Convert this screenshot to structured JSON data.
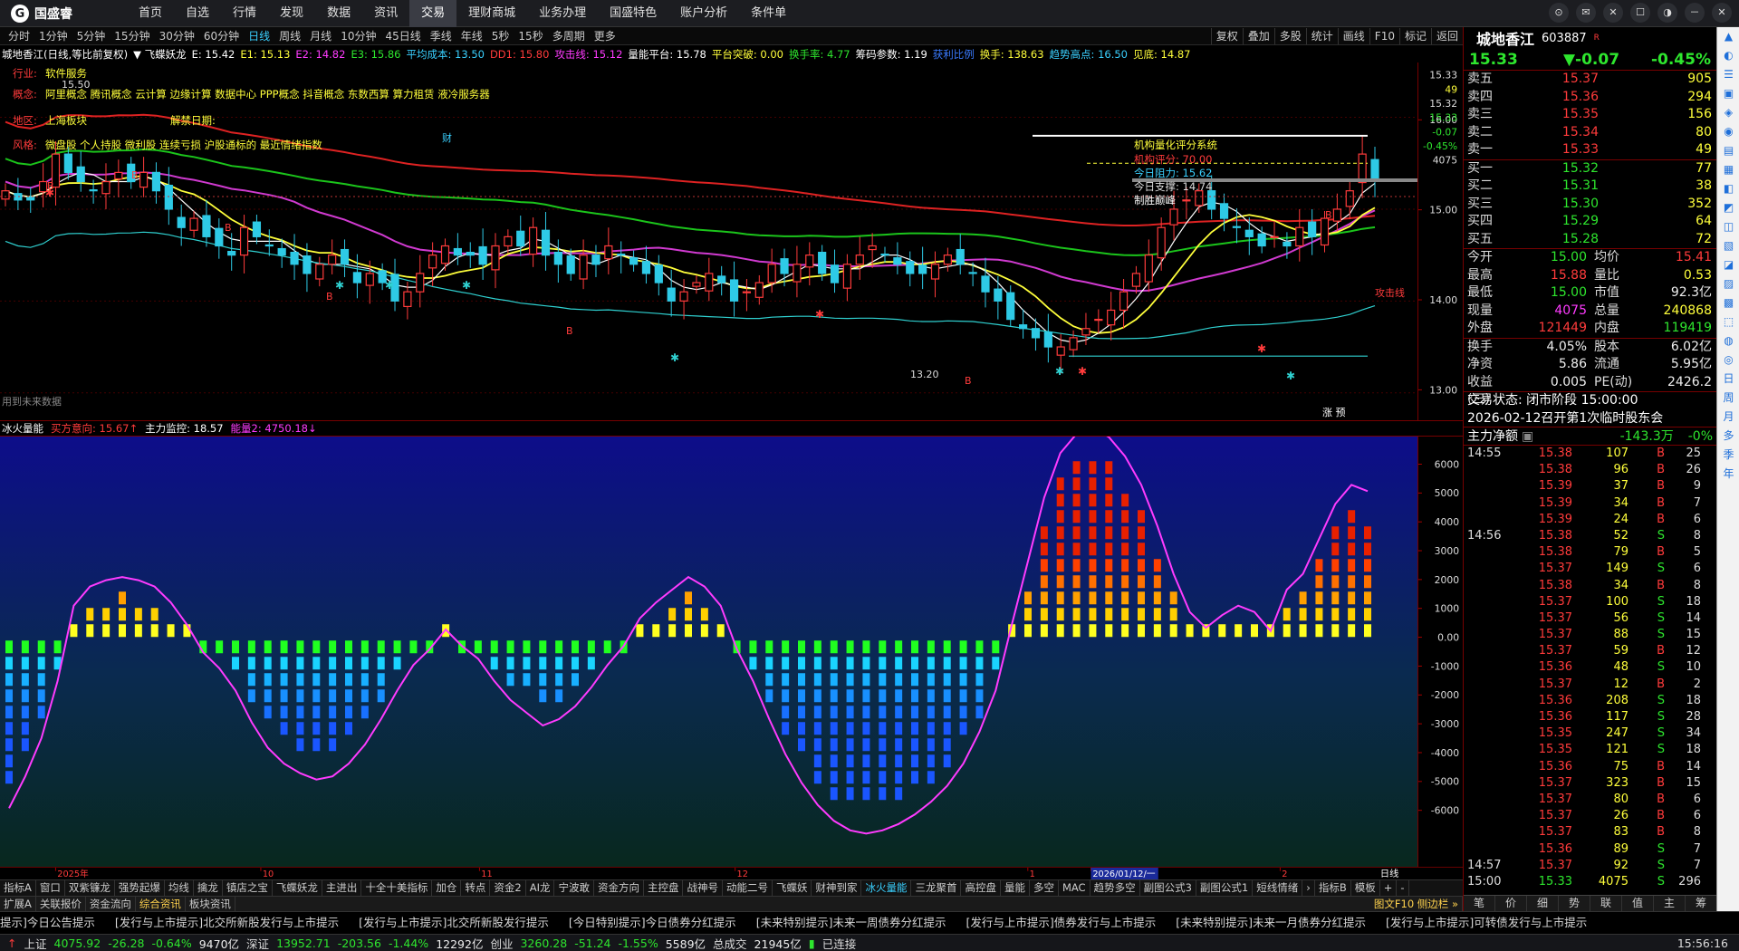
{
  "app": {
    "logo_text": "国盛睿",
    "logo_mark": "G"
  },
  "menu": [
    "首页",
    "自选",
    "行情",
    "发现",
    "数据",
    "资讯",
    "交易",
    "理财商城",
    "业务办理",
    "国盛特色",
    "账户分析",
    "条件单"
  ],
  "menu_active": "交易",
  "window_buttons": [
    "⊙",
    "✉",
    "✕",
    "☐",
    "◑",
    "－",
    "✕"
  ],
  "periods": [
    "分时",
    "1分钟",
    "5分钟",
    "15分钟",
    "30分钟",
    "60分钟",
    "日线",
    "周线",
    "月线",
    "10分钟",
    "45日线",
    "季线",
    "年线",
    "5秒",
    "15秒",
    "多周期",
    "更多"
  ],
  "period_active": "日线",
  "right_tools": [
    "复权",
    "叠加",
    "多股",
    "统计",
    "画线",
    "F10",
    "标记",
    "返回"
  ],
  "info": [
    {
      "text": "城地香江(日线,等比前复权)",
      "color": "#ffffff"
    },
    {
      "text": "▼ 飞蝶妖龙",
      "color": "#ffffff"
    },
    {
      "text": "E: 15.42",
      "color": "#ffffff"
    },
    {
      "text": "E1: 15.13",
      "color": "#ffff3b"
    },
    {
      "text": "E2: 14.82",
      "color": "#ff3bff"
    },
    {
      "text": "E3: 15.86",
      "color": "#2ee62e"
    },
    {
      "text": "平均成本: 13.50",
      "color": "#3ad0ff"
    },
    {
      "text": "DD1: 15.80",
      "color": "#ff3b3b"
    },
    {
      "text": "攻击线: 15.12",
      "color": "#ff3bff"
    },
    {
      "text": "量能平台: 15.78",
      "color": "#ffffff"
    },
    {
      "text": "平台突破: 0.00",
      "color": "#ffff3b"
    },
    {
      "text": "换手率: 4.77",
      "color": "#2ee62e"
    },
    {
      "text": "筹码参数: 1.19",
      "color": "#ffffff"
    },
    {
      "text": "获利比例",
      "color": "#3a7bff"
    },
    {
      "text": "换手: 138.63",
      "color": "#ffff3b"
    },
    {
      "text": "趋势高点: 16.50",
      "color": "#3ad0ff"
    },
    {
      "text": "见底: 14.87",
      "color": "#ffff3b"
    }
  ],
  "overlay": {
    "industry_label": "行业:",
    "industry": "软件服务",
    "concept_label": "概念:",
    "concepts": "阿里概念 腾讯概念 云计算 边缘计算 数据中心 PPP概念 抖音概念 东数西算 算力租赁 液冷服务器",
    "region_label": "地区:",
    "region": "上海板块",
    "lift_label": "解禁日期:",
    "style_label": "风格:",
    "style": "微盘股 个人持股 微利股 连续亏损 沪股通标的 最近情绪指数",
    "bottom_left": "用到未来数据",
    "low_label": "13.20",
    "high_label": "15.50",
    "score_title": "机构量化评分系统",
    "score_lines": [
      "机构评分: 70.00",
      "今日阻力: 15.62",
      "今日支撑: 14.74",
      "制胜巅峰"
    ]
  },
  "chart_data": [
    {
      "type": "candlestick",
      "title": "城地香江(日线,等比前复权)",
      "ylim": [
        12.8,
        16.4
      ],
      "y_ticks": [
        13.0,
        14.0,
        15.0,
        16.0
      ],
      "top_ticks": [
        "15.33",
        "49",
        "15.32",
        "15.33",
        "-0.07",
        "-0.45%",
        "4075"
      ],
      "ma_labels": [
        "E",
        "E1",
        "E2",
        "E3",
        "平均成本",
        "DD1",
        "攻击线",
        "量能平台"
      ],
      "close_series": [
        15.2,
        15.1,
        15.1,
        15.3,
        15.6,
        15.4,
        15.3,
        15.2,
        15.3,
        15.4,
        15.3,
        15.4,
        15.2,
        15.0,
        14.8,
        14.9,
        14.7,
        14.6,
        14.5,
        14.8,
        14.7,
        14.6,
        14.5,
        14.4,
        14.3,
        14.4,
        14.5,
        14.4,
        14.2,
        14.3,
        14.2,
        14.0,
        14.1,
        14.3,
        14.5,
        14.6,
        14.5,
        14.5,
        14.4,
        14.6,
        14.7,
        14.6,
        14.8,
        14.5,
        14.4,
        14.3,
        14.5,
        14.4,
        14.6,
        14.5,
        14.4,
        14.3,
        14.2,
        14.0,
        14.1,
        14.2,
        14.3,
        14.2,
        14.0,
        14.1,
        14.2,
        14.4,
        14.3,
        14.4,
        14.5,
        14.3,
        14.2,
        14.4,
        14.5,
        14.6,
        14.5,
        14.4,
        14.3,
        14.3,
        14.4,
        14.5,
        14.4,
        14.3,
        14.1,
        14.0,
        13.8,
        13.7,
        13.6,
        13.5,
        13.5,
        13.6,
        13.7,
        13.8,
        13.9,
        14.1,
        14.3,
        14.5,
        14.8,
        15.0,
        15.1,
        15.2,
        15.0,
        14.9,
        14.8,
        14.7,
        14.6,
        14.7,
        14.6,
        14.8,
        14.7,
        14.9,
        15.0,
        15.2,
        15.6,
        15.33
      ],
      "axis_dates": [
        "2025年",
        "10",
        "11",
        "12",
        "1",
        "2026/01/12/一",
        "2"
      ]
    },
    {
      "type": "bar",
      "title": "冰火量能",
      "indicators": [
        {
          "name": "买方意向",
          "value": "15.67"
        },
        {
          "name": "主力监控",
          "value": "18.57"
        },
        {
          "name": "能量2",
          "value": "4750.18"
        }
      ],
      "ylim": [
        -7500,
        6500
      ],
      "y_ticks": [
        6000,
        5000,
        4000,
        3000,
        2000,
        1000,
        0,
        -1000,
        -2000,
        -3000,
        -4000,
        -5000,
        -6000
      ],
      "values": [
        -5200,
        -4200,
        -3000,
        -1200,
        800,
        1400,
        1600,
        1700,
        1600,
        1400,
        900,
        200,
        -300,
        -800,
        -1500,
        -2500,
        -3300,
        -3800,
        -4100,
        -4300,
        -4200,
        -3800,
        -3200,
        -2400,
        -1500,
        -700,
        -200,
        50,
        -100,
        -500,
        -1200,
        -1800,
        -2200,
        -2600,
        -2400,
        -2000,
        -1400,
        -700,
        -100,
        400,
        900,
        1300,
        1700,
        1400,
        800,
        -200,
        -1200,
        -2400,
        -3500,
        -4400,
        -5100,
        -5600,
        -5900,
        -6000,
        -5900,
        -5700,
        -5400,
        -5000,
        -4500,
        -3800,
        -2800,
        -1500,
        200,
        2200,
        4200,
        5600,
        6200,
        6400,
        6100,
        5500,
        4600,
        3300,
        1800,
        600,
        100,
        500,
        800,
        600,
        0,
        1300,
        1800,
        2900,
        4000,
        4600,
        4400
      ]
    }
  ],
  "right_panel": {
    "name": "城地香江",
    "code": "603887",
    "tag": "R",
    "price": "15.33",
    "change": "▼-0.07",
    "pct": "-0.45%",
    "asks": [
      {
        "l": "卖五",
        "p": "15.37",
        "v": "905"
      },
      {
        "l": "卖四",
        "p": "15.36",
        "v": "294"
      },
      {
        "l": "卖三",
        "p": "15.35",
        "v": "156"
      },
      {
        "l": "卖二",
        "p": "15.34",
        "v": "80"
      },
      {
        "l": "卖一",
        "p": "15.33",
        "v": "49"
      }
    ],
    "bids": [
      {
        "l": "买一",
        "p": "15.32",
        "v": "77"
      },
      {
        "l": "买二",
        "p": "15.31",
        "v": "38"
      },
      {
        "l": "买三",
        "p": "15.30",
        "v": "352"
      },
      {
        "l": "买四",
        "p": "15.29",
        "v": "64"
      },
      {
        "l": "买五",
        "p": "15.28",
        "v": "72"
      }
    ],
    "quote": [
      {
        "l": "今开",
        "v": "15.00",
        "c": "green",
        "l2": "均价",
        "v2": "15.41",
        "c2": "red"
      },
      {
        "l": "最高",
        "v": "15.88",
        "c": "red",
        "l2": "量比",
        "v2": "0.53",
        "c2": "yellow"
      },
      {
        "l": "最低",
        "v": "15.00",
        "c": "green",
        "l2": "市值",
        "v2": "92.3亿",
        "c2": "white"
      },
      {
        "l": "现量",
        "v": "4075",
        "c": "magenta",
        "l2": "总量",
        "v2": "240868",
        "c2": "yellow"
      },
      {
        "l": "外盘",
        "v": "121449",
        "c": "red",
        "l2": "内盘",
        "v2": "119419",
        "c2": "green"
      }
    ],
    "quote2": [
      {
        "l": "换手",
        "v": "4.05%",
        "l2": "股本",
        "v2": "6.02亿"
      },
      {
        "l": "净资",
        "v": "5.86",
        "l2": "流通",
        "v2": "5.95亿"
      },
      {
        "l": "收益(三)",
        "v": "0.005",
        "l2": "PE(动)",
        "v2": "2426.2"
      }
    ],
    "trade_status": "交易状态: 闭市阶段 15:00:00",
    "meeting": "2026-02-12召开第1次临时股东会",
    "main_flow_label": "主力净额",
    "main_flow_value": "-143.3万",
    "main_flow_pct": "-0%",
    "ticks": [
      {
        "t": "14:55",
        "p": "15.38",
        "q": "107",
        "d": "B",
        "n": "25"
      },
      {
        "t": "",
        "p": "15.38",
        "q": "96",
        "d": "B",
        "n": "26"
      },
      {
        "t": "",
        "p": "15.39",
        "q": "37",
        "d": "B",
        "n": "9"
      },
      {
        "t": "",
        "p": "15.39",
        "q": "34",
        "d": "B",
        "n": "7"
      },
      {
        "t": "",
        "p": "15.39",
        "q": "24",
        "d": "B",
        "n": "6"
      },
      {
        "t": "14:56",
        "p": "15.38",
        "q": "52",
        "d": "S",
        "n": "8"
      },
      {
        "t": "",
        "p": "15.38",
        "q": "79",
        "d": "B",
        "n": "5"
      },
      {
        "t": "",
        "p": "15.37",
        "q": "149",
        "d": "S",
        "n": "6"
      },
      {
        "t": "",
        "p": "15.38",
        "q": "34",
        "d": "B",
        "n": "8"
      },
      {
        "t": "",
        "p": "15.37",
        "q": "100",
        "d": "S",
        "n": "18"
      },
      {
        "t": "",
        "p": "15.37",
        "q": "56",
        "d": "S",
        "n": "14"
      },
      {
        "t": "",
        "p": "15.37",
        "q": "88",
        "d": "S",
        "n": "15"
      },
      {
        "t": "",
        "p": "15.37",
        "q": "59",
        "d": "B",
        "n": "12"
      },
      {
        "t": "",
        "p": "15.36",
        "q": "48",
        "d": "S",
        "n": "10"
      },
      {
        "t": "",
        "p": "15.37",
        "q": "12",
        "d": "B",
        "n": "2"
      },
      {
        "t": "",
        "p": "15.36",
        "q": "208",
        "d": "S",
        "n": "18"
      },
      {
        "t": "",
        "p": "15.36",
        "q": "117",
        "d": "S",
        "n": "28"
      },
      {
        "t": "",
        "p": "15.35",
        "q": "247",
        "d": "S",
        "n": "34"
      },
      {
        "t": "",
        "p": "15.35",
        "q": "121",
        "d": "S",
        "n": "18"
      },
      {
        "t": "",
        "p": "15.36",
        "q": "75",
        "d": "B",
        "n": "14"
      },
      {
        "t": "",
        "p": "15.37",
        "q": "323",
        "d": "B",
        "n": "15"
      },
      {
        "t": "",
        "p": "15.37",
        "q": "80",
        "d": "B",
        "n": "6"
      },
      {
        "t": "",
        "p": "15.37",
        "q": "26",
        "d": "B",
        "n": "6"
      },
      {
        "t": "",
        "p": "15.37",
        "q": "83",
        "d": "B",
        "n": "8"
      },
      {
        "t": "",
        "p": "15.36",
        "q": "89",
        "d": "S",
        "n": "7"
      },
      {
        "t": "14:57",
        "p": "15.37",
        "q": "92",
        "d": "S",
        "n": "7"
      },
      {
        "t": "15:00",
        "p": "15.33",
        "q": "4075",
        "d": "S",
        "n": "296"
      }
    ],
    "bottom_tabs": [
      "笔",
      "价",
      "细",
      "势",
      "联",
      "值",
      "主",
      "筹"
    ]
  },
  "vertical_sidebar": [
    "▲",
    "◐",
    "☰",
    "▣",
    "◈",
    "◉",
    "▤",
    "▦",
    "◧",
    "◩",
    "◫",
    "▧",
    "◪",
    "▨",
    "▩",
    "⬚",
    "◍",
    "◎",
    "日",
    "周",
    "月",
    "多",
    "季",
    "年"
  ],
  "indicator_tabs": [
    "指标A",
    "窗口",
    "双紫镰龙",
    "强势起爆",
    "均线",
    "擒龙",
    "镇店之宝",
    "飞蝶妖龙",
    "主进出",
    "十全十美指标",
    "加仓",
    "转点",
    "资金2",
    "AI龙",
    "宁波敢",
    "资金方向",
    "主控盘",
    "战神号",
    "动能二号",
    "飞蝶妖",
    "财神到家",
    "冰火量能",
    "三龙聚首",
    "高控盘",
    "量能",
    "多空",
    "MAC",
    "趋势多空",
    "副图公式3",
    "副图公式1",
    "短线情绪",
    "›",
    "指标B",
    "模板",
    "+",
    "-"
  ],
  "indicator_active": "冰火量能",
  "bottom_tabs": [
    "扩展A",
    "关联报价",
    "资金流向",
    "综合资讯",
    "板块资讯"
  ],
  "bottom_active": "综合资讯",
  "right_link": "图文F10 侧边栏 »",
  "ticker": [
    "提示]今日公告提示",
    "[发行与上市提示]北交所新股发行与上市提示",
    "[发行与上市提示]北交所新股发行提示",
    "[今日特别提示]今日债券分红提示",
    "[未来特别提示]未来一周债券分红提示",
    "[发行与上市提示]债券发行与上市提示",
    "[未来特别提示]未来一月债券分红提示",
    "[发行与上市提示]可转债发行与上市提示"
  ],
  "status": {
    "sh_label": "上证",
    "sh": "4075.92",
    "sh_chg": "-26.28",
    "sh_pct": "-0.64%",
    "sh_amt": "9470亿",
    "sz_label": "深证",
    "sz": "13952.71",
    "sz_chg": "-203.56",
    "sz_pct": "-1.44%",
    "sz_amt": "12292亿",
    "cy_label": "创业",
    "cy": "3260.28",
    "cy_chg": "-51.24",
    "cy_pct": "-1.55%",
    "cy_amt": "5589亿",
    "total_label": "总成交",
    "total": "21945亿",
    "conn": "已连接",
    "time": "15:56:16"
  },
  "colors": {
    "up": "#ff3b3b",
    "down": "#2ee62e",
    "bg": "#000000",
    "grid": "#700000"
  }
}
